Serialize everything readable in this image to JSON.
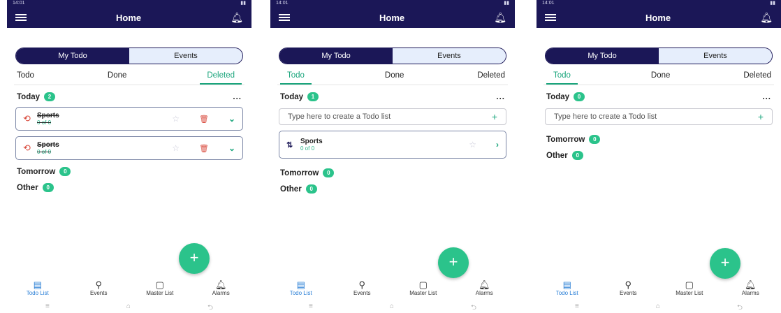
{
  "screens": [
    {
      "status": {
        "left": "14:01",
        "right": ""
      },
      "title": "Home",
      "segment": {
        "active": "My Todo",
        "inactive": "Events"
      },
      "tabs": [
        "Todo",
        "Done",
        "Deleted"
      ],
      "today": {
        "label": "Today",
        "count": "2"
      },
      "tasks": [
        {
          "name": "Sports",
          "sub": "0 of 0"
        },
        {
          "name": "Sports",
          "sub": "0 of 0"
        }
      ],
      "tomorrow": {
        "label": "Tomorrow",
        "count": "0"
      },
      "other": {
        "label": "Other",
        "count": "0"
      }
    },
    {
      "status": {
        "left": "14:01",
        "right": ""
      },
      "title": "Home",
      "segment": {
        "active": "My Todo",
        "inactive": "Events"
      },
      "tabs": [
        "Todo",
        "Done",
        "Deleted"
      ],
      "today": {
        "label": "Today",
        "count": "1"
      },
      "input_placeholder": "Type here to create a Todo list",
      "tasks": [
        {
          "name": "Sports",
          "sub": "0 of 0"
        }
      ],
      "tomorrow": {
        "label": "Tomorrow",
        "count": "0"
      },
      "other": {
        "label": "Other",
        "count": "0"
      }
    },
    {
      "status": {
        "left": "14:01",
        "right": ""
      },
      "title": "Home",
      "segment": {
        "active": "My Todo",
        "inactive": "Events"
      },
      "tabs": [
        "Todo",
        "Done",
        "Deleted"
      ],
      "today": {
        "label": "Today",
        "count": "0"
      },
      "input_placeholder": "Type here to create a Todo list",
      "tomorrow": {
        "label": "Tomorrow",
        "count": "0"
      },
      "other": {
        "label": "Other",
        "count": "0"
      }
    }
  ],
  "bottom_nav": [
    "Todo List",
    "Events",
    "Master List",
    "Alarms"
  ],
  "dots": "...",
  "colors": {
    "appbar": "#1b1757",
    "accent": "#2bc38b",
    "delete": "#d94a3d"
  }
}
